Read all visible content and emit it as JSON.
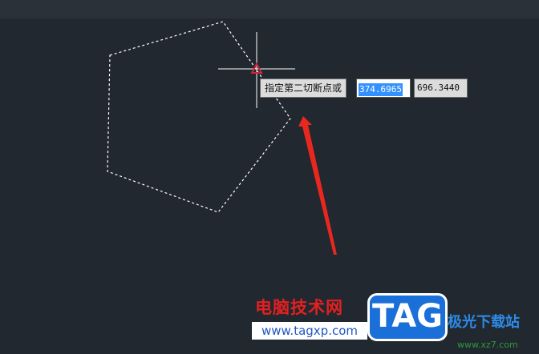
{
  "prompt": {
    "label": "指定第二切断点或"
  },
  "coordinates": {
    "x_value": "374.6965",
    "y_value": "696.3440"
  },
  "watermark": {
    "site_name": "电脑技术网",
    "site_url": "www.tagxp.com",
    "badge": "TAG",
    "right_text": "极光下载站",
    "right_domain": "www.xz7.com"
  },
  "colors": {
    "canvas_background": "#212830",
    "crosshair": "#ffffff",
    "snap_marker": "#d0253a",
    "arrow": "#e8271e",
    "selection_highlight": "#3390ff"
  }
}
